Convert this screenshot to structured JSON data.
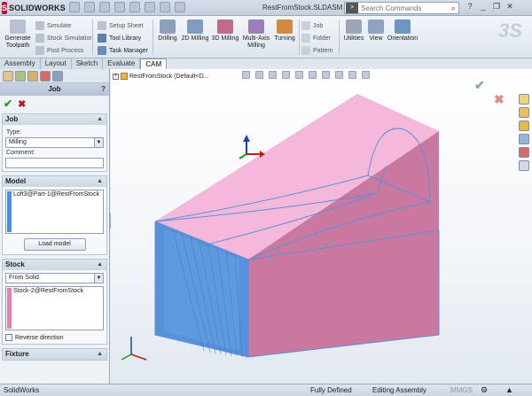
{
  "app": {
    "logo_text": "SOLIDWORKS",
    "doc_title": "RestFromStock.SLDASM *",
    "search_placeholder": "Search Commands"
  },
  "ribbon": {
    "generate_toolpath": "Generate Toolpath",
    "simulate": "Simulate",
    "stock_simulation": "Stock Simulation",
    "post_process": "Post Process",
    "setup_sheet": "Setup Sheet",
    "tool_library": "Tool Library",
    "task_manager": "Task Manager",
    "drilling": "Drilling",
    "milling_2d": "2D Milling",
    "milling_3d": "3D Milling",
    "multi_axis": "Multi-Axis Milling",
    "turning": "Turning",
    "job": "Job",
    "folder": "Folder",
    "pattern": "Pattern",
    "utilities": "Utilities",
    "view": "View",
    "orientation": "Orientation"
  },
  "tabs": [
    "Assembly",
    "Layout",
    "Sketch",
    "Evaluate",
    "CAM"
  ],
  "active_tab": "CAM",
  "panel": {
    "title": "Job",
    "help": "?",
    "job_group": {
      "title": "Job",
      "type_label": "Type:",
      "type_value": "Milling",
      "comment_label": "Comment:",
      "comment_value": ""
    },
    "model_group": {
      "title": "Model",
      "item": "Loft3@Part-1@RestFromStock",
      "bar_color": "#4a90e2",
      "load_button": "Load model"
    },
    "stock_group": {
      "title": "Stock",
      "source": "From Solid",
      "item": "Stock-2@RestFromStock",
      "bar_color": "#e87fb4",
      "reverse_label": "Reverse direction",
      "reverse_checked": false
    },
    "fixture_group": {
      "title": "Fixture"
    }
  },
  "viewport": {
    "tree_label": "RestFromStock  (Default<D...",
    "stock_color": "#e58fbf",
    "model_color": "#4a8fd9"
  },
  "status": {
    "app": "SolidWorks",
    "state": "Fully Defined",
    "mode": "Editing Assembly",
    "units": "MMGS"
  }
}
